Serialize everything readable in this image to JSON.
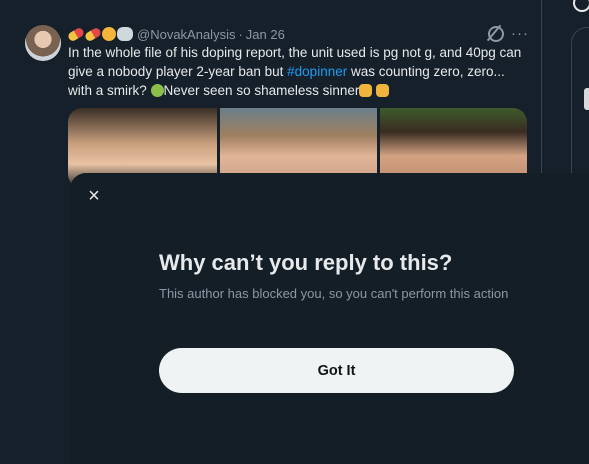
{
  "tweet": {
    "handle": "@NovakAnalysis",
    "separator": "·",
    "date": "Jan 26",
    "more_label": "···",
    "text_part1": "In the whole file of his doping report, the unit used is pg not g, and 40pg can give a nobody player 2-year ban but ",
    "hashtag": "#dopinner",
    "text_part2": " was counting zero, zero... with a smirk? ",
    "text_part3": "Never seen so shameless sinner",
    "icons": [
      "pill-emoji",
      "pill-emoji",
      "face-emoji",
      "speech-emoji",
      "grok-icon",
      "more-icon"
    ]
  },
  "dialog": {
    "close_label": "×",
    "title": "Why can’t you reply to this?",
    "body": "This author has blocked you, so you can't perform this action",
    "button_label": "Got It"
  },
  "colors": {
    "background": "#15202b",
    "link": "#1d9bf0",
    "button_bg": "#eff3f4",
    "muted_text": "#8b98a5"
  }
}
